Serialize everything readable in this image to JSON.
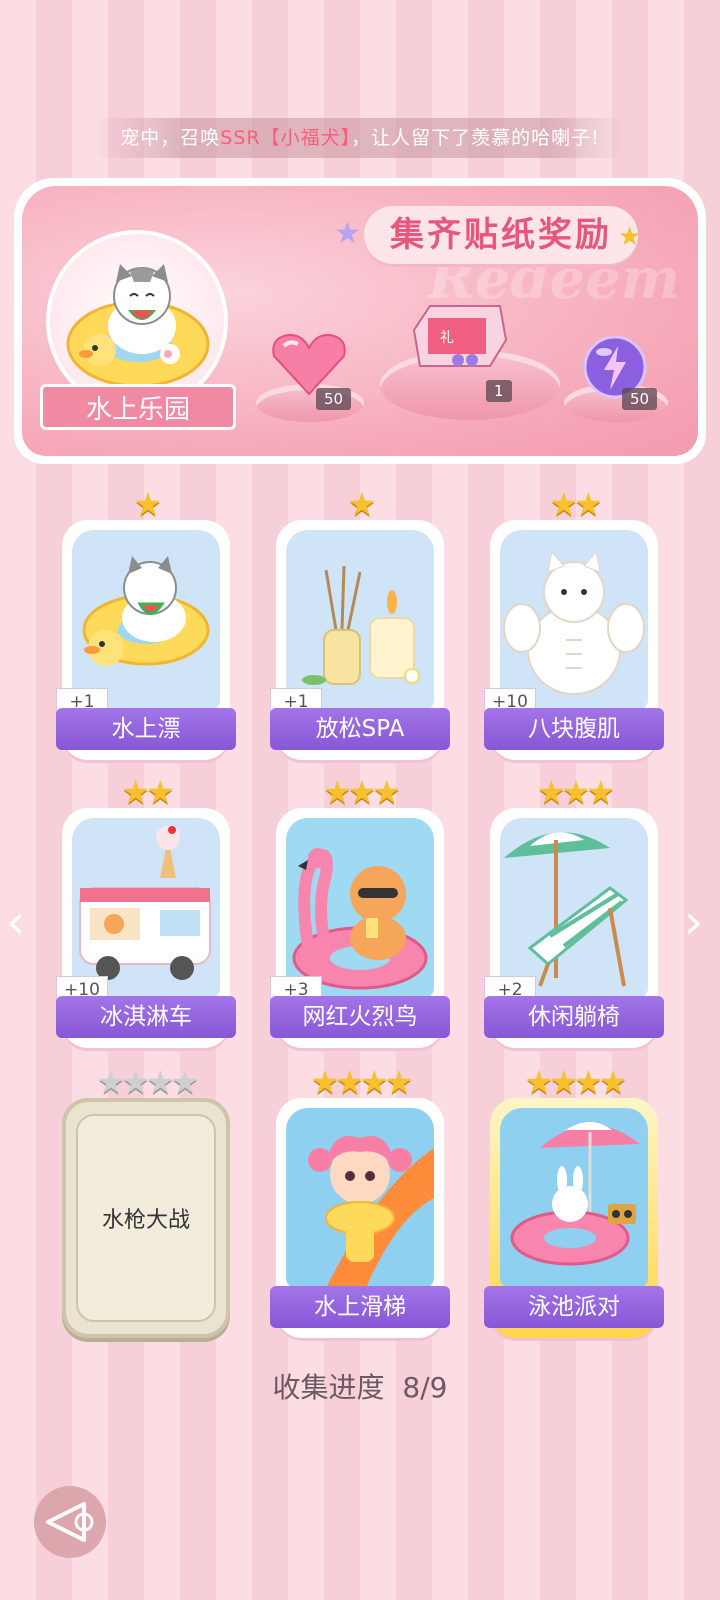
{
  "marquee": {
    "prefix": "宠中，召唤",
    "highlight": "SSR【小福犬】",
    "suffix": "，让人留下了羡慕的哈喇子!"
  },
  "banner": {
    "title": "集齐贴纸奖励",
    "watermark": "Redeem",
    "theme_label": "水上乐园",
    "rewards": [
      {
        "name": "pink-heart-gem",
        "count": "50"
      },
      {
        "name": "gift-box",
        "count": "1"
      },
      {
        "name": "purple-energy-orb",
        "count": "50"
      }
    ]
  },
  "cards": [
    {
      "label": "水上漂",
      "stars": 1,
      "plus": "+1",
      "locked": false
    },
    {
      "label": "放松SPA",
      "stars": 1,
      "plus": "+1",
      "locked": false
    },
    {
      "label": "八块腹肌",
      "stars": 2,
      "plus": "+10",
      "locked": false
    },
    {
      "label": "冰淇淋车",
      "stars": 2,
      "plus": "+10",
      "locked": false
    },
    {
      "label": "网红火烈鸟",
      "stars": 3,
      "plus": "+3",
      "locked": false
    },
    {
      "label": "休闲躺椅",
      "stars": 3,
      "plus": "+2",
      "locked": false
    },
    {
      "label": "水枪大战",
      "stars": 4,
      "plus": "",
      "locked": true
    },
    {
      "label": "水上滑梯",
      "stars": 4,
      "plus": "",
      "locked": false
    },
    {
      "label": "泳池派对",
      "stars": 4,
      "plus": "",
      "locked": false
    }
  ],
  "progress": {
    "label": "收集进度",
    "value": "8/9"
  },
  "colors": {
    "accent": "#8757d6",
    "banner_pink": "#f39ab0",
    "title_pink": "#e7577b",
    "star_gold": "#f7c02d"
  }
}
